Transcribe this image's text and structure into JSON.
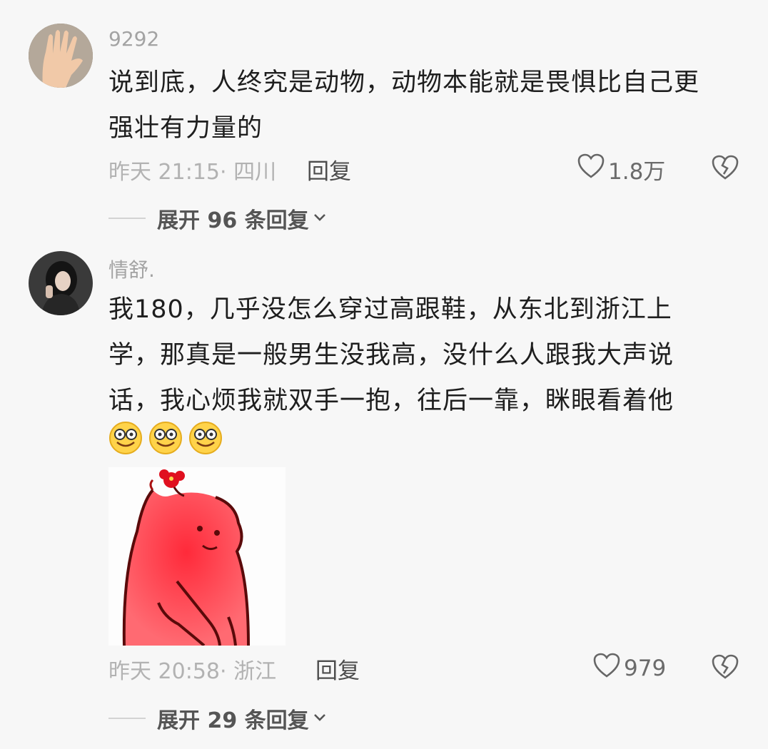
{
  "comments": [
    {
      "username": "9292",
      "text": "说到底，人终究是动物，动物本能就是畏惧比自己更\n强壮有力量的",
      "meta": "昨天 21:15· 四川",
      "reply_label": "回复",
      "likes": "1.8万",
      "expand_label": "展开 96 条回复"
    },
    {
      "username": "情舒.",
      "text": "我180，几乎没怎么穿过高跟鞋，从东北到浙江上\n学，那真是一般男生没我高，没什么人跟我大声说\n话，我心烦我就双手一抱，往后一靠，眯眼看着他",
      "meta": "昨天 20:58· 浙江",
      "reply_label": "回复",
      "likes": "979",
      "expand_label": "展开 29 条回复"
    }
  ],
  "colors": {
    "background": "#f7f7f7",
    "secondary_text": "#b2b2b2",
    "sticker_red": "#ff3d4a"
  }
}
